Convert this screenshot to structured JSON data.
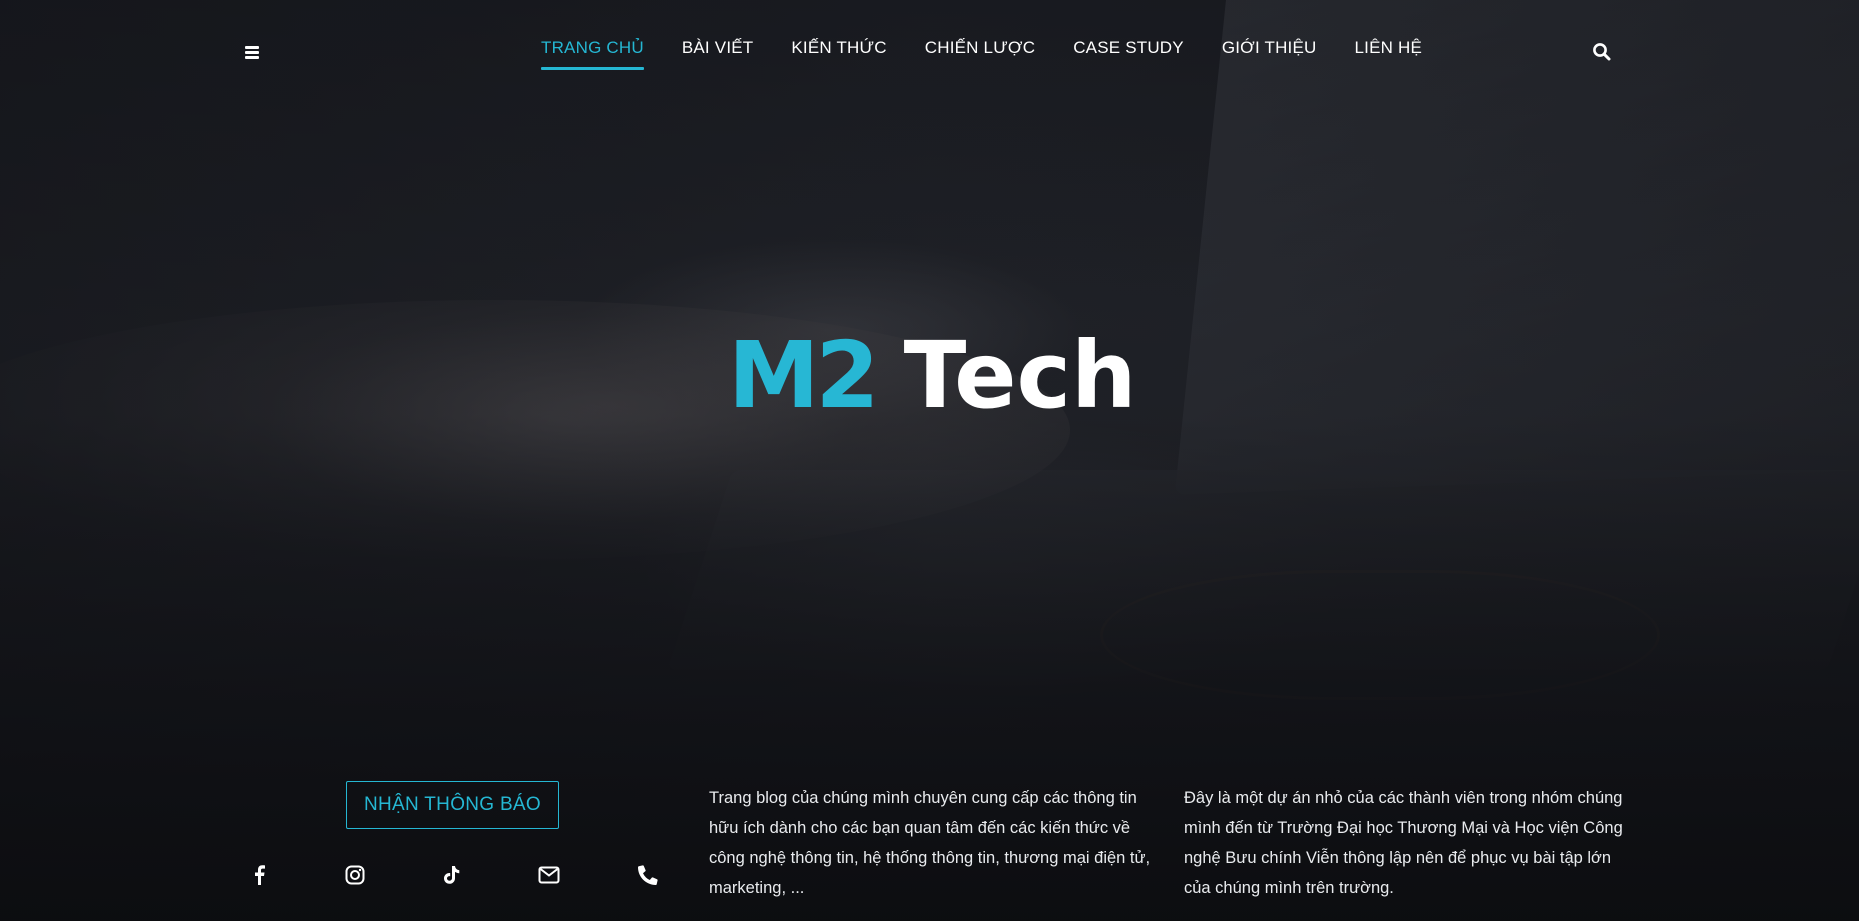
{
  "nav": {
    "items": [
      {
        "label": "TRANG CHỦ",
        "active": true
      },
      {
        "label": "BÀI VIẾT",
        "active": false
      },
      {
        "label": "KIẾN THỨC",
        "active": false
      },
      {
        "label": "CHIẾN LƯỢC",
        "active": false
      },
      {
        "label": "CASE STUDY",
        "active": false
      },
      {
        "label": "GIỚI THIỆU",
        "active": false
      },
      {
        "label": "LIÊN HỆ",
        "active": false
      }
    ]
  },
  "icons": {
    "menu": "hamburger-menu-icon",
    "search": "search-icon"
  },
  "logo": {
    "part1": "M2",
    "part2": "Tech"
  },
  "subscribe": {
    "label": "NHẬN THÔNG BÁO"
  },
  "socials": [
    "facebook-icon",
    "instagram-icon",
    "tiktok-icon",
    "email-icon",
    "phone-icon"
  ],
  "about": {
    "text1": "Trang blog của chúng mình chuyên cung cấp các thông tin hữu ích dành cho các bạn quan tâm đến các kiến thức về công nghệ thông tin, hệ thống thông tin, thương mại điện tử, marketing, ...",
    "text2": "Đây là một dự án nhỏ của các thành viên trong nhóm chúng mình đến từ Trường Đại học Thương Mại và Học viện Công nghệ Bưu chính Viễn thông lập nên để phục vụ bài tập lớn của chúng mình trên trường."
  },
  "colors": {
    "accent": "#25b7d3",
    "text": "#ffffff"
  }
}
